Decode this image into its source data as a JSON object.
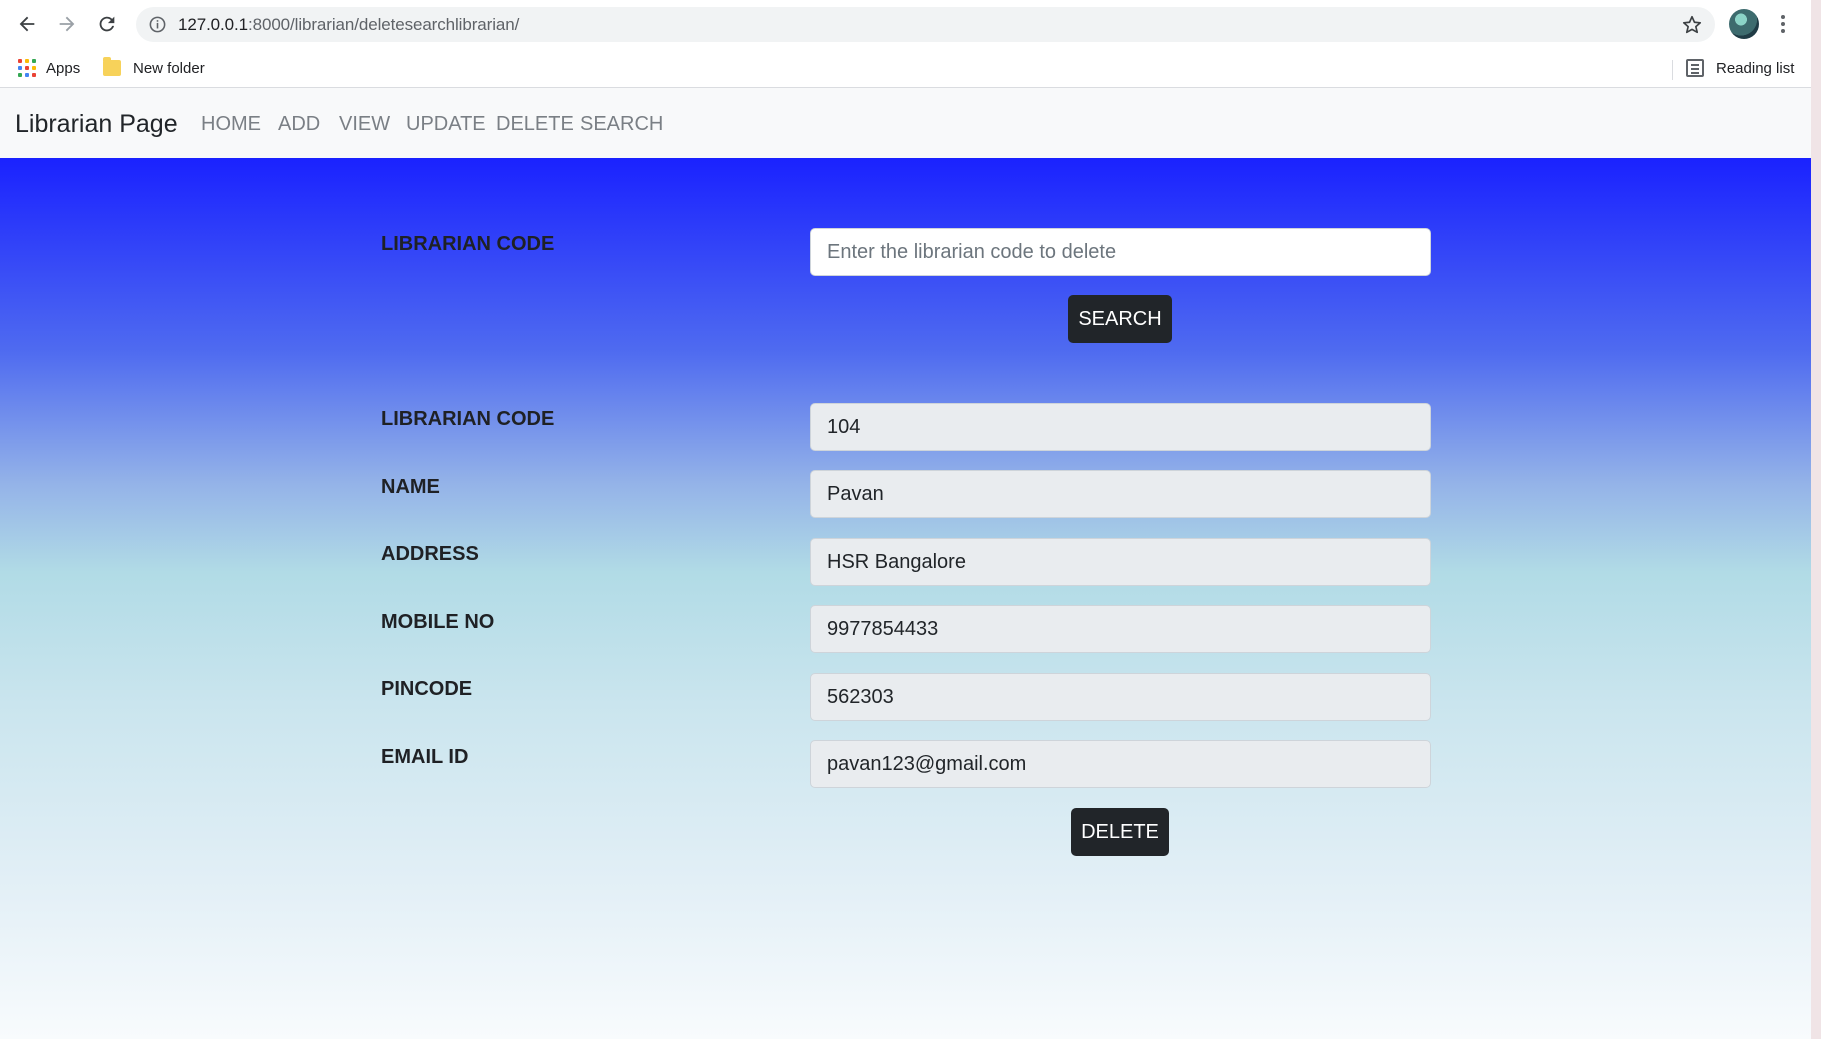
{
  "browser": {
    "url_host": "127.0.0.1",
    "url_rest": ":8000/librarian/deletesearchlibrarian/",
    "bookmarks": {
      "apps": "Apps",
      "new_folder": "New folder",
      "reading_list": "Reading list"
    }
  },
  "navbar": {
    "brand": "Librarian Page",
    "links": [
      "HOME",
      "ADD",
      "VIEW",
      "UPDATE",
      "DELETE",
      "SEARCH"
    ]
  },
  "search_form": {
    "label": "LIBRARIAN CODE",
    "placeholder": "Enter the librarian code to delete",
    "button": "SEARCH"
  },
  "record": {
    "fields": [
      {
        "label": "LIBRARIAN CODE",
        "value": "104"
      },
      {
        "label": "NAME",
        "value": "Pavan"
      },
      {
        "label": "ADDRESS",
        "value": "HSR Bangalore"
      },
      {
        "label": "MOBILE NO",
        "value": "9977854433"
      },
      {
        "label": "PINCODE",
        "value": "562303"
      },
      {
        "label": "EMAIL ID",
        "value": "pavan123@gmail.com"
      }
    ],
    "button": "DELETE"
  },
  "colors": {
    "gradient_top": "#1a22ff",
    "gradient_bottom": "#f8fbfd",
    "button_bg": "#212529"
  }
}
